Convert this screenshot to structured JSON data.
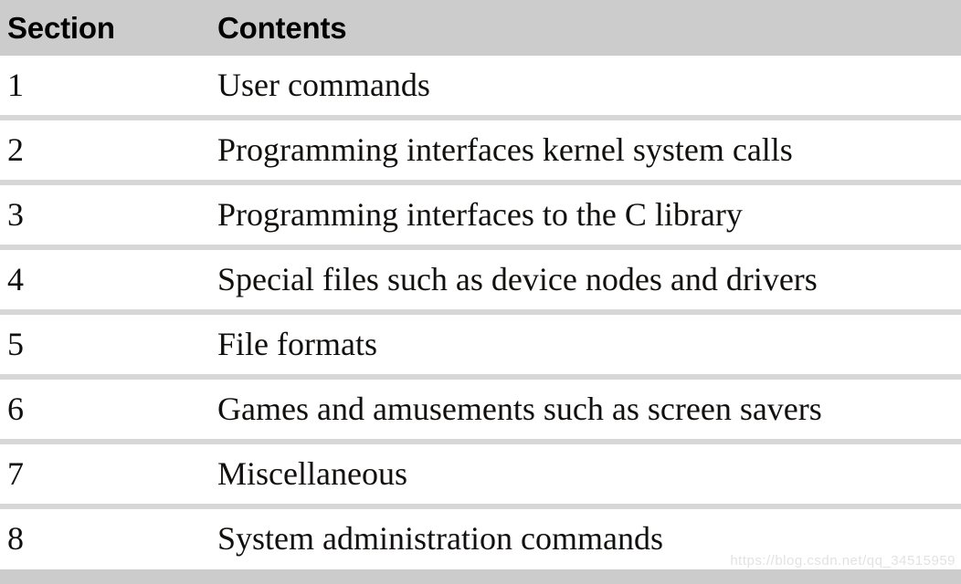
{
  "table": {
    "columns": [
      {
        "key": "section",
        "label": "Section"
      },
      {
        "key": "contents",
        "label": "Contents"
      }
    ],
    "rows": [
      {
        "section": "1",
        "contents": "User commands"
      },
      {
        "section": "2",
        "contents": "Programming interfaces kernel system calls"
      },
      {
        "section": "3",
        "contents": "Programming interfaces to the C library"
      },
      {
        "section": "4",
        "contents": "Special files such as device nodes and drivers"
      },
      {
        "section": "5",
        "contents": "File formats"
      },
      {
        "section": "6",
        "contents": "Games and amusements such as screen savers"
      },
      {
        "section": "7",
        "contents": "Miscellaneous"
      },
      {
        "section": "8",
        "contents": "System administration commands"
      }
    ]
  },
  "watermark": {
    "text": "https://blog.csdn.net/qq_34515959"
  },
  "colors": {
    "header_background": "#cccccc",
    "row_separator": "#d7d7d7",
    "row_background": "#ffffff",
    "text": "#12100e",
    "watermark_text": "#e2e2e2",
    "bottom_band": "#cccccc"
  }
}
